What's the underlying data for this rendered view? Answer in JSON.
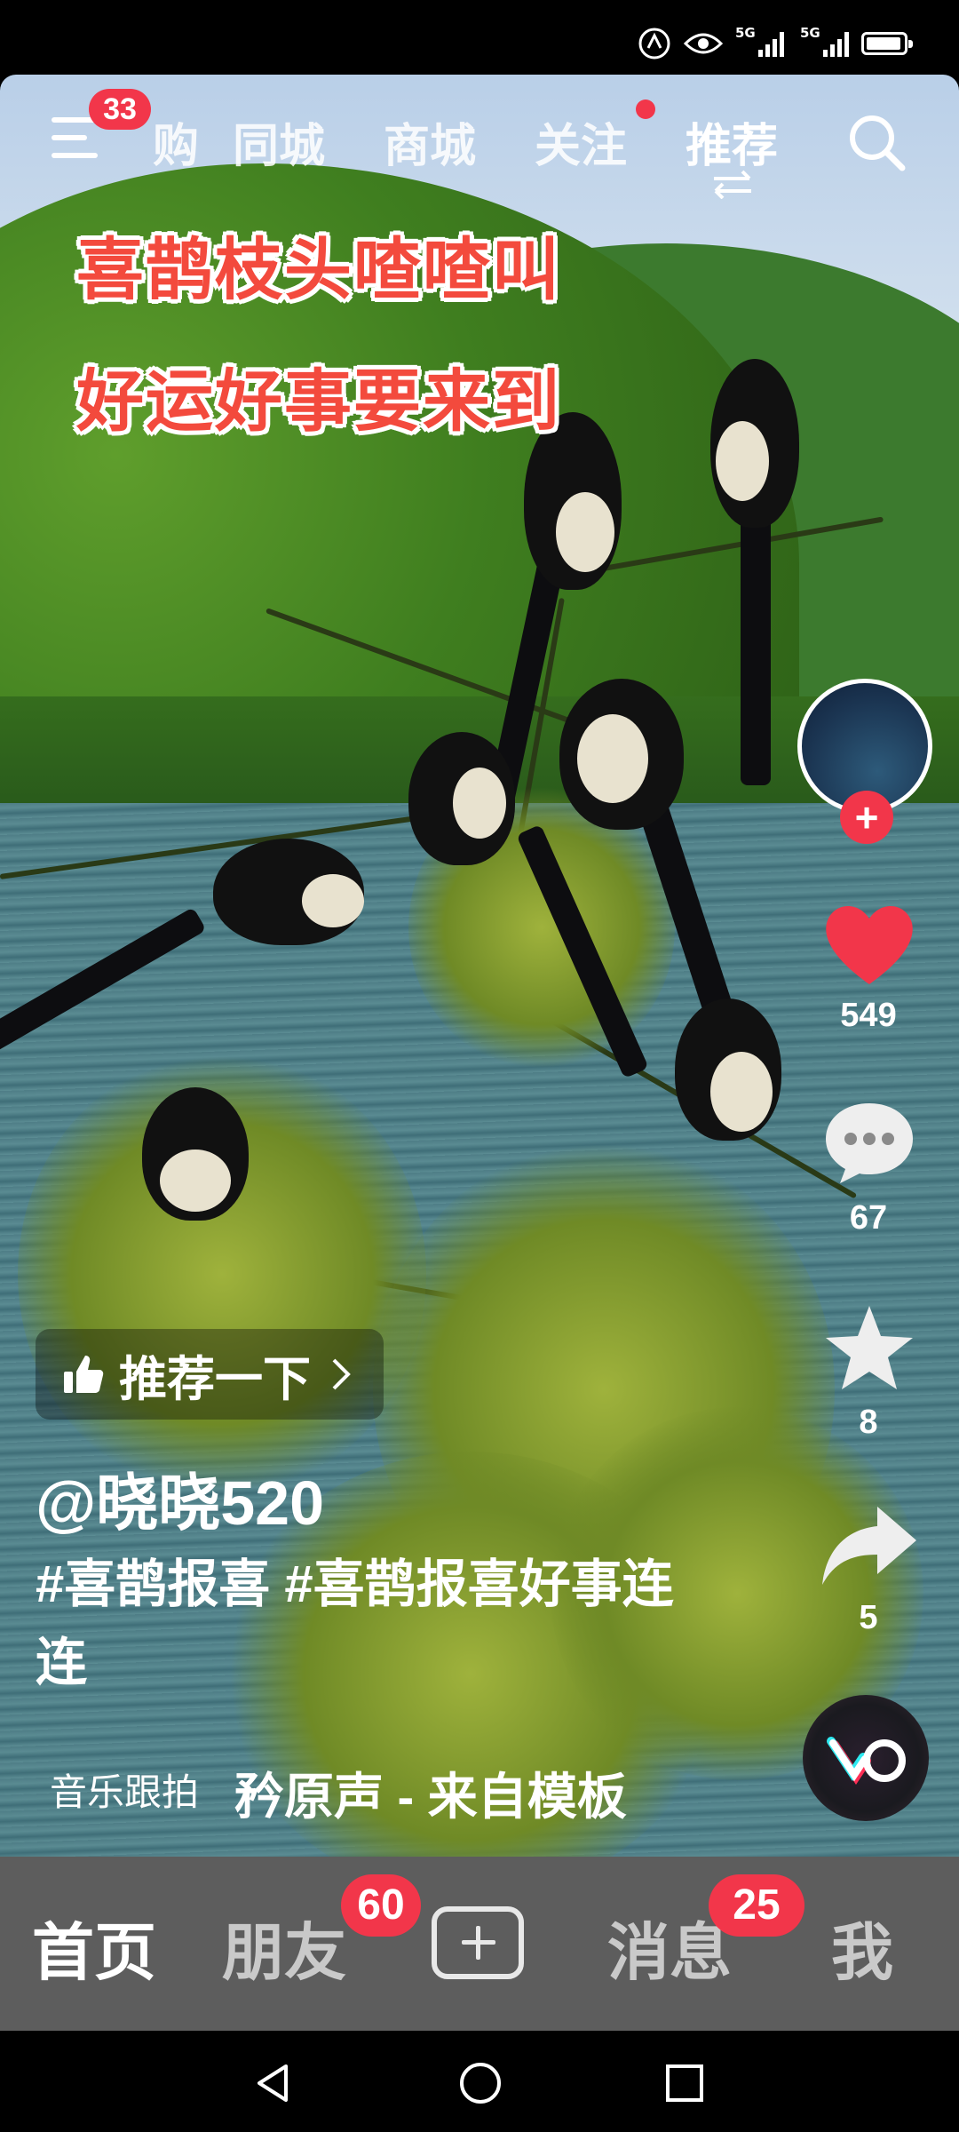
{
  "status_bar": {
    "network_tags": [
      "5G",
      "5G"
    ]
  },
  "top_nav": {
    "menu_badge": "33",
    "tabs": [
      {
        "label": "购",
        "active": false
      },
      {
        "label": "同城",
        "active": false
      },
      {
        "label": "商城",
        "active": false
      },
      {
        "label": "关注",
        "active": false,
        "dot": true
      },
      {
        "label": "推荐",
        "active": true
      }
    ]
  },
  "video": {
    "caption_lines": [
      "喜鹊枝头喳喳叫",
      "好运好事要来到"
    ]
  },
  "actions": {
    "likes": "549",
    "comments": "67",
    "favorites": "8",
    "shares": "5"
  },
  "info": {
    "recommend_label": "推荐一下",
    "username": "@晓晓520",
    "description": "#喜鹊报喜 #喜鹊报喜好事连连",
    "music_label": "音乐跟拍",
    "music_name": "矜原声 - 来自模板"
  },
  "bottom_nav": {
    "items": [
      {
        "label": "首页",
        "active": true
      },
      {
        "label": "朋友",
        "badge": "60"
      },
      {
        "label": "消息",
        "badge": "25"
      },
      {
        "label": "我"
      }
    ]
  },
  "colors": {
    "accent": "#f2364a",
    "caption": "#f34a3d",
    "bottom_bar": "#5d5d5d"
  }
}
